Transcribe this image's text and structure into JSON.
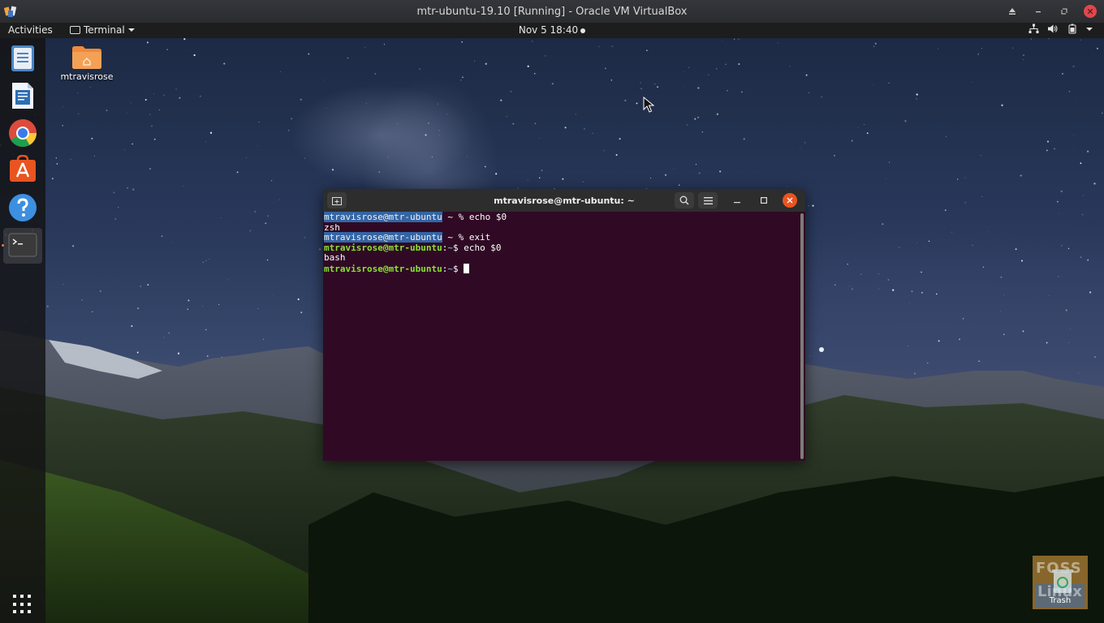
{
  "host_window": {
    "title": "mtr-ubuntu-19.10 [Running] - Oracle VM VirtualBox",
    "close_color": "#e0474c"
  },
  "top_bar": {
    "activities": "Activities",
    "app_menu": "Terminal",
    "clock": "Nov 5  18:40",
    "tray_icons": [
      "network-icon",
      "volume-icon",
      "battery-icon",
      "menu-arrow-icon"
    ]
  },
  "dock": {
    "items": [
      {
        "name": "files",
        "icon": "files-icon"
      },
      {
        "name": "libreoffice-writer",
        "icon": "writer-icon"
      },
      {
        "name": "chrome",
        "icon": "chrome-icon"
      },
      {
        "name": "ubuntu-software",
        "icon": "software-icon"
      },
      {
        "name": "help",
        "icon": "help-icon"
      },
      {
        "name": "terminal",
        "icon": "terminal-icon",
        "active": true
      }
    ],
    "accent": "#f07746"
  },
  "desktop": {
    "home_folder_label": "mtravisrose",
    "trash_label": "Trash",
    "watermark_top": "FOSS",
    "watermark_bottom": "Linux"
  },
  "terminal": {
    "title": "mtravisrose@mtr-ubuntu: ~",
    "accent_close": "#e95420",
    "background": "#300a24",
    "lines": [
      {
        "kind": "zsh",
        "user": "mtravisrose@mtr-ubuntu",
        "rest": " ~ % echo $0"
      },
      {
        "kind": "output",
        "text": "zsh"
      },
      {
        "kind": "zsh",
        "user": "mtravisrose@mtr-ubuntu",
        "rest": " ~ % exit"
      },
      {
        "kind": "bash",
        "user": "mtravisrose@mtr-ubuntu",
        "sep": ":",
        "path": "~",
        "rest": "$ echo $0"
      },
      {
        "kind": "output",
        "text": "bash"
      },
      {
        "kind": "bash",
        "user": "mtravisrose@mtr-ubuntu",
        "sep": ":",
        "path": "~",
        "rest": "$ "
      }
    ]
  }
}
